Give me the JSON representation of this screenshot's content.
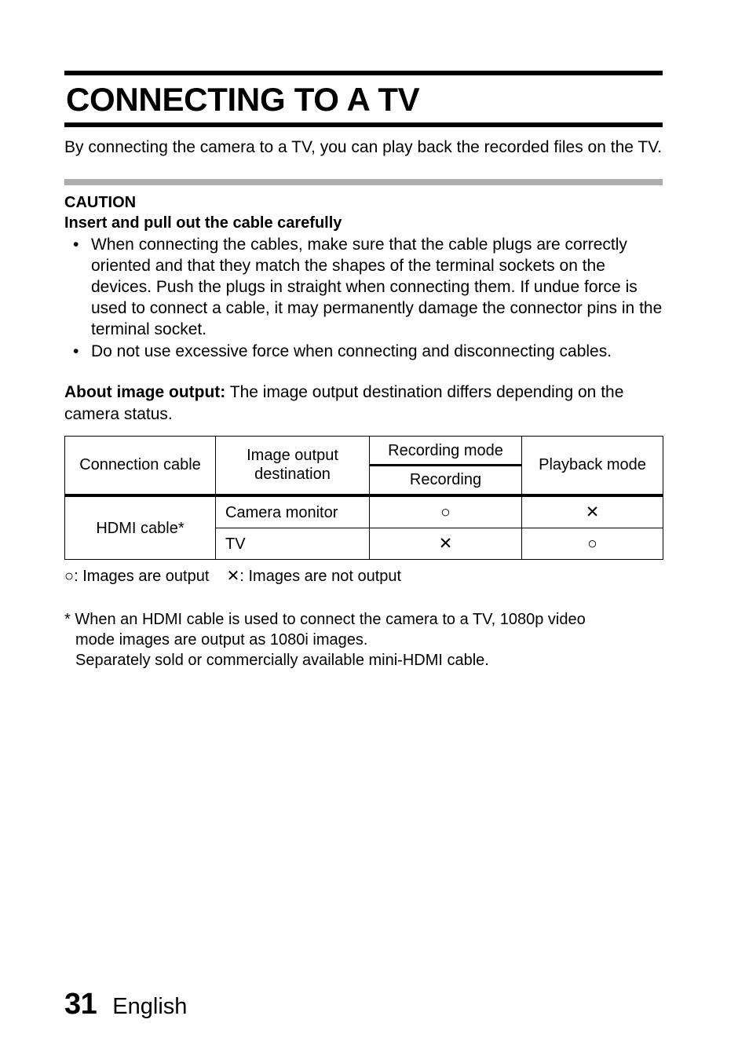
{
  "document": {
    "title": "CONNECTING TO A TV",
    "intro": "By connecting the camera to a TV, you can play back the recorded files on the TV."
  },
  "caution": {
    "heading": "CAUTION",
    "subheading": "Insert and pull out the cable carefully",
    "bullet_marker": "•",
    "items": [
      "When connecting the cables, make sure that the cable plugs are correctly oriented and that they match the shapes of the terminal sockets on the devices. Push the plugs in straight when connecting them. If undue force is used to connect a cable, it may permanently damage the connector pins in the terminal socket.",
      "Do not use excessive force when connecting and disconnecting cables."
    ]
  },
  "about_image_output": {
    "label": "About image output:",
    "text": " The image output destination differs depending on the camera status."
  },
  "table": {
    "headers": {
      "connection_cable": "Connection cable",
      "image_output_destination": "Image output destination",
      "recording_mode": "Recording mode",
      "recording": "Recording",
      "playback_mode": "Playback mode"
    },
    "rows": [
      {
        "cable": "HDMI cable*",
        "destination": "Camera monitor",
        "recording": "○",
        "playback": "✕"
      },
      {
        "cable": "",
        "destination": "TV",
        "recording": "✕",
        "playback": "○"
      }
    ]
  },
  "legend": {
    "text": "○: Images are output    ✕: Images are not output"
  },
  "footnote": {
    "line1": "* When an HDMI cable is used to connect the camera to a TV, 1080p video",
    "line2": "mode images are output as 1080i images.",
    "line3": "Separately sold or commercially available mini-HDMI cable."
  },
  "footer": {
    "page_number": "31",
    "language": "English"
  },
  "colors": {
    "rule": "#000000",
    "separator_gray": "#adadad",
    "text": "#000000",
    "background": "#ffffff"
  }
}
